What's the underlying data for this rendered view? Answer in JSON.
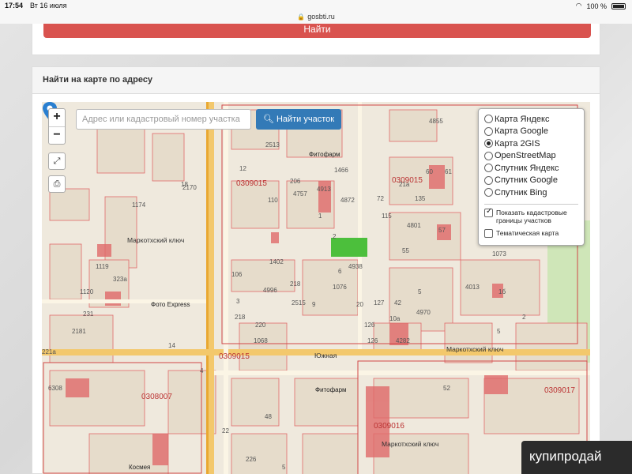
{
  "status": {
    "time": "17:54",
    "date": "Вт 16 июля",
    "battery": "100 %"
  },
  "browser": {
    "domain": "gosbti.ru"
  },
  "top_button": {
    "label": "Найти"
  },
  "panel": {
    "title": "Найти на карте по адресу"
  },
  "map_controls": {
    "zoom_in": "+",
    "zoom_out": "−"
  },
  "search": {
    "placeholder": "Адрес или кадастровый номер участка",
    "button_label": "Найти участок"
  },
  "layers": {
    "options": [
      "Карта Яндекс",
      "Карта Google",
      "Карта 2GIS",
      "OpenStreetMap",
      "Спутник Яндекс",
      "Спутник Google",
      "Спутник Bing"
    ],
    "selected": "Карта 2GIS",
    "checkbox_cadastral": "Показать кадастровые границы участков",
    "checkbox_thematic": "Тематическая карта"
  },
  "map_labels": {
    "quarters": [
      "0309015",
      "0309015",
      "0309015",
      "0308007",
      "0309016",
      "0309017"
    ],
    "streets": [
      "Южная",
      "Маркотхский ключ",
      "Маркотхский ключ",
      "Маркотхский ключ"
    ],
    "pois": [
      "Фитофарм",
      "Фото Express",
      "Фитофарм",
      "Космея"
    ],
    "numbers": [
      "4855",
      "2513",
      "1466",
      "4872",
      "110",
      "135",
      "4801",
      "1073",
      "1402",
      "4938",
      "4996",
      "1076",
      "4970",
      "1120",
      "2181",
      "221а",
      "1068",
      "126",
      "4282",
      "6308",
      "1174",
      "1119",
      "323а",
      "231",
      "14",
      "6",
      "4",
      "22",
      "52",
      "48",
      "226",
      "5",
      "4",
      "12",
      "18",
      "55",
      "60",
      "61",
      "21а",
      "2170",
      "206",
      "4757",
      "4913",
      "72",
      "1",
      "115",
      "2",
      "220",
      "12б",
      "10а",
      "5",
      "57",
      "4013",
      "1б",
      "106",
      "218",
      "2515",
      "218",
      "9",
      "127",
      "42",
      "3",
      "20",
      "5",
      "2"
    ]
  },
  "watermark": {
    "text": "купипродай"
  }
}
